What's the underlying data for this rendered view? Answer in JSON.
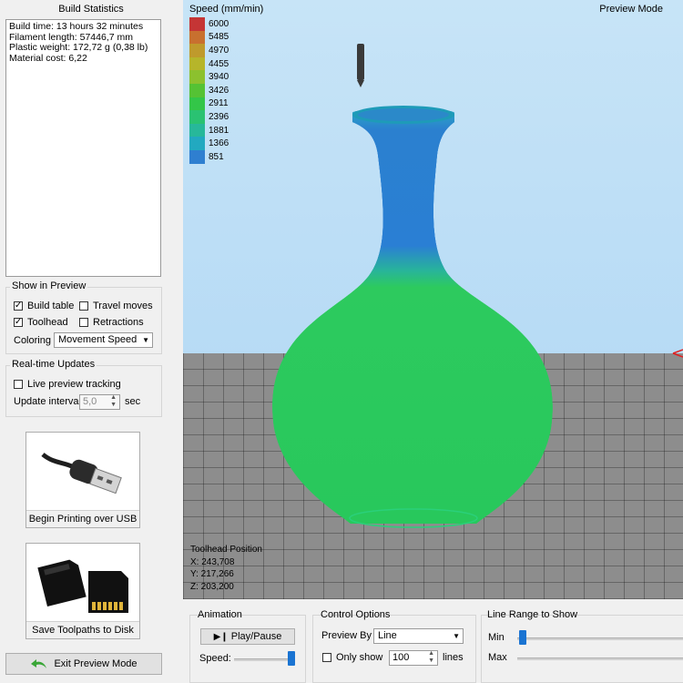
{
  "left": {
    "stats_title": "Build Statistics",
    "stats": [
      "Build time: 13 hours 32 minutes",
      "Filament length: 57446,7 mm",
      "Plastic weight: 172,72 g (0,38 lb)",
      "Material cost: 6,22"
    ],
    "show_in_preview": {
      "title": "Show in Preview",
      "build_table": "Build table",
      "travel_moves": "Travel moves",
      "toolhead": "Toolhead",
      "retractions": "Retractions",
      "coloring_label": "Coloring",
      "coloring_value": "Movement Speed",
      "build_table_checked": true,
      "travel_moves_checked": false,
      "toolhead_checked": true,
      "retractions_checked": false
    },
    "realtime": {
      "title": "Real-time Updates",
      "live_tracking": "Live preview tracking",
      "live_tracking_checked": false,
      "interval_label": "Update interval",
      "interval_value": "5,0",
      "interval_unit": "sec"
    },
    "usb_button": "Begin Printing over USB",
    "sd_button": "Save Toolpaths to Disk",
    "exit_button": "Exit Preview Mode"
  },
  "viewport": {
    "mode_label": "Preview Mode",
    "legend_title": "Speed (mm/min)",
    "legend": [
      {
        "value": "6000",
        "color": "#c53535"
      },
      {
        "value": "5485",
        "color": "#c8702f"
      },
      {
        "value": "4970",
        "color": "#bf9a2c"
      },
      {
        "value": "4455",
        "color": "#b6b52a"
      },
      {
        "value": "3940",
        "color": "#8cc12e"
      },
      {
        "value": "3426",
        "color": "#55c234"
      },
      {
        "value": "2911",
        "color": "#33c648"
      },
      {
        "value": "2396",
        "color": "#2ac272"
      },
      {
        "value": "1881",
        "color": "#27b89a"
      },
      {
        "value": "1366",
        "color": "#22a9c0"
      },
      {
        "value": "851",
        "color": "#2f7fd0"
      }
    ],
    "toolhead": {
      "title": "Toolhead Position",
      "x": "X: 243,708",
      "y": "Y: 217,266",
      "z": "Z: 203,200"
    }
  },
  "animation": {
    "title": "Animation",
    "play_pause": "Play/Pause",
    "speed_label": "Speed:"
  },
  "control": {
    "title": "Control Options",
    "preview_by_label": "Preview By",
    "preview_by_value": "Line",
    "only_show": "Only show",
    "only_show_checked": false,
    "count": "100",
    "count_unit": "lines"
  },
  "line_range": {
    "title": "Line Range to Show",
    "min_label": "Min",
    "max_label": "Max"
  }
}
